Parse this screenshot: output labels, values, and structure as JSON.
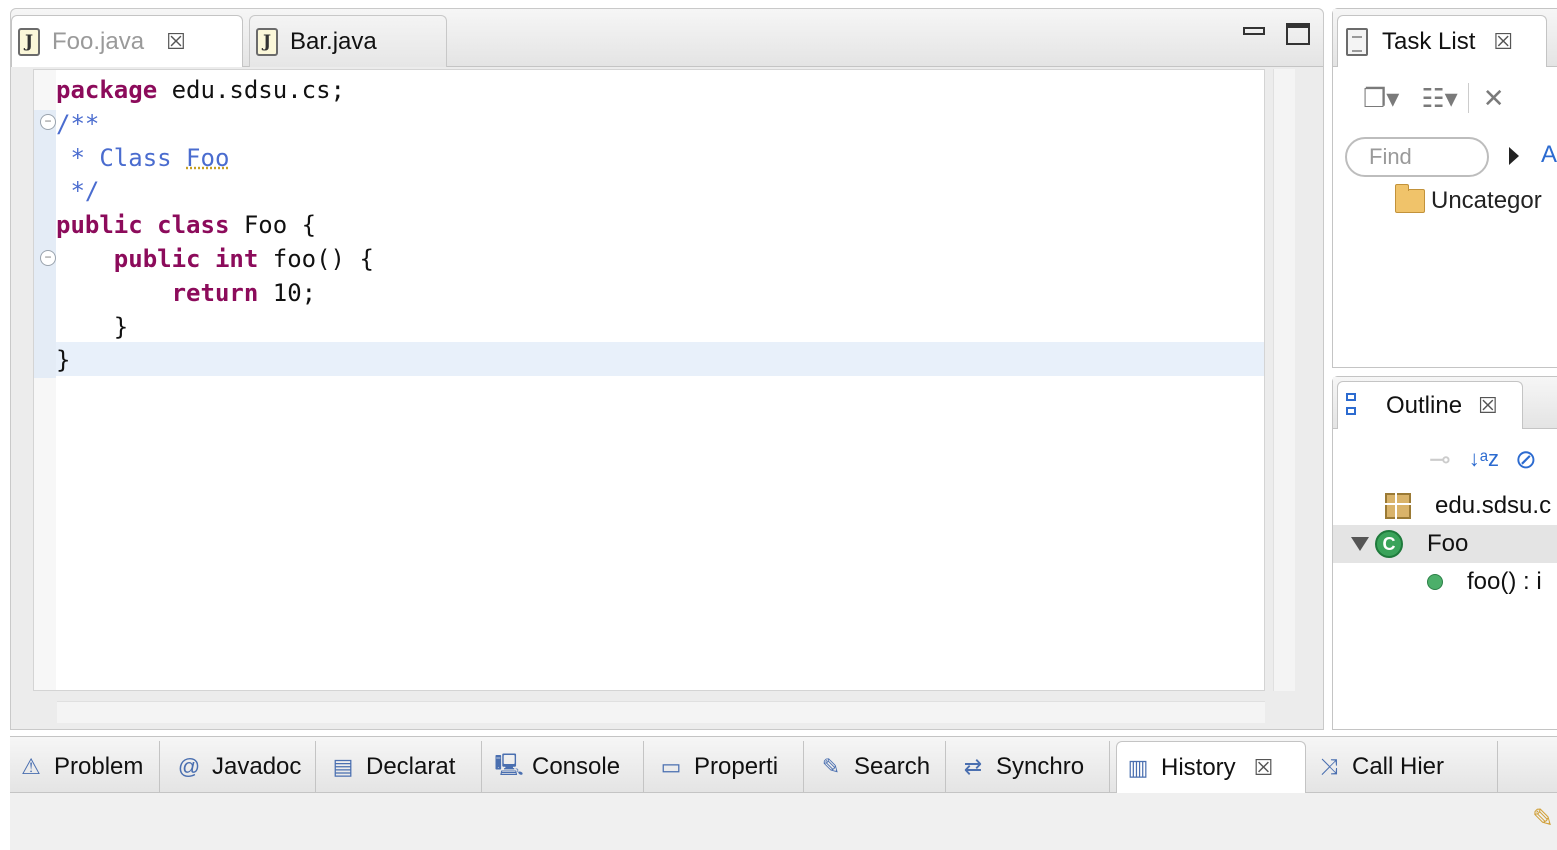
{
  "editor": {
    "tabs": [
      {
        "label": "Foo.java",
        "icon": "java-file-icon",
        "active": true,
        "icon_letter": "J"
      },
      {
        "label": "Bar.java",
        "icon": "java-file-icon",
        "active": false,
        "icon_letter": "J"
      }
    ],
    "close_glyph": "☒",
    "code_lines": [
      [
        {
          "t": "package",
          "c": "kw"
        },
        {
          "t": " edu.sdsu.cs;",
          "c": ""
        }
      ],
      [
        {
          "t": "/**",
          "c": "cm"
        }
      ],
      [
        {
          "t": " * Class ",
          "c": "cm"
        },
        {
          "t": "Foo",
          "c": "cm-u"
        }
      ],
      [
        {
          "t": " */",
          "c": "cm"
        }
      ],
      [
        {
          "t": "public",
          "c": "kw"
        },
        {
          "t": " ",
          "c": ""
        },
        {
          "t": "class",
          "c": "kw"
        },
        {
          "t": " Foo {",
          "c": ""
        }
      ],
      [
        {
          "t": "    ",
          "c": ""
        },
        {
          "t": "public",
          "c": "kw"
        },
        {
          "t": " ",
          "c": ""
        },
        {
          "t": "int",
          "c": "kw"
        },
        {
          "t": " foo() {",
          "c": ""
        }
      ],
      [
        {
          "t": "        ",
          "c": ""
        },
        {
          "t": "return",
          "c": "kw"
        },
        {
          "t": " 10;",
          "c": ""
        }
      ],
      [
        {
          "t": "    }",
          "c": ""
        }
      ],
      [
        {
          "t": "}",
          "c": ""
        }
      ]
    ]
  },
  "task_list": {
    "title": "Task List",
    "find_placeholder": "Find",
    "link_partial": "A",
    "folder_label": "Uncategor"
  },
  "outline": {
    "title": "Outline",
    "items": [
      {
        "label": "edu.sdsu.c",
        "icon": "package-icon"
      },
      {
        "label": "Foo",
        "icon": "class-icon",
        "selected": true,
        "class_letter": "C"
      },
      {
        "label": "foo() : i",
        "icon": "method-icon"
      }
    ]
  },
  "bottom_tabs": [
    {
      "label": "Problem",
      "icon": "problems-icon",
      "glyph": "⚠"
    },
    {
      "label": "Javadoc",
      "icon": "javadoc-icon",
      "glyph": "@"
    },
    {
      "label": "Declarat",
      "icon": "declaration-icon",
      "glyph": "▤"
    },
    {
      "label": "Console",
      "icon": "console-icon",
      "glyph": "🖳"
    },
    {
      "label": "Properti",
      "icon": "properties-icon",
      "glyph": "▭"
    },
    {
      "label": "Search",
      "icon": "search-icon",
      "glyph": "✎"
    },
    {
      "label": "Synchro",
      "icon": "synchronize-icon",
      "glyph": "⇄"
    },
    {
      "label": "History",
      "icon": "history-icon",
      "glyph": "▥",
      "active": true
    },
    {
      "label": "Call Hier",
      "icon": "call-hierarchy-icon",
      "glyph": "⤨"
    }
  ],
  "colors": {
    "keyword": "#8c0b5b",
    "comment": "#4a6ccf",
    "current_line": "#e8f0fa"
  }
}
